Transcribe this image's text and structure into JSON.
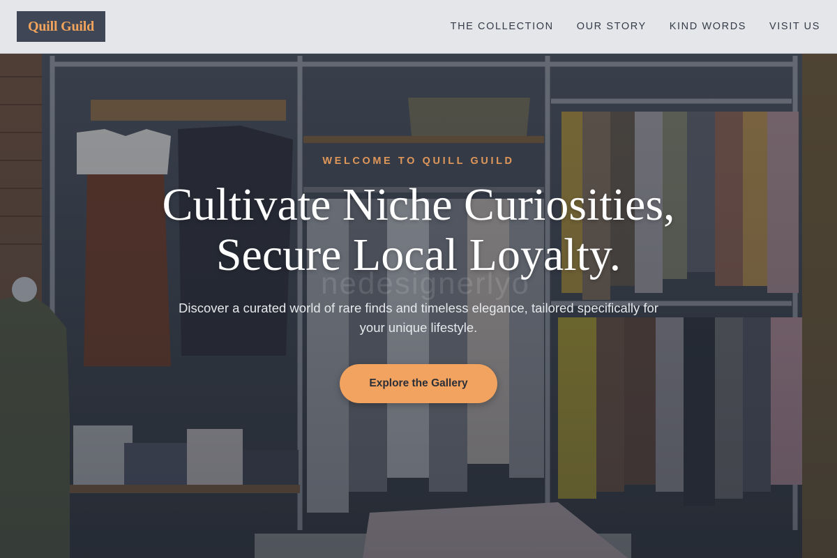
{
  "brand": {
    "logo_text": "Quill Guild"
  },
  "nav": {
    "items": [
      {
        "label": "THE COLLECTION"
      },
      {
        "label": "OUR STORY"
      },
      {
        "label": "KIND WORDS"
      },
      {
        "label": "VISIT US"
      }
    ]
  },
  "hero": {
    "kicker": "WELCOME TO QUILL GUILD",
    "headline_line1": "Cultivate Niche Curiosities,",
    "headline_line2": "Secure Local Loyalty.",
    "watermark": "nedesignerlyo",
    "subtext": "Discover a curated world of rare finds and timeless elegance, tailored specifically for your unique lifestyle.",
    "cta_label": "Explore the Gallery"
  },
  "colors": {
    "accent": "#f2a35f",
    "kicker": "#e0975a",
    "logo_bg": "#3f4656",
    "header_bg": "#e9ebef"
  }
}
